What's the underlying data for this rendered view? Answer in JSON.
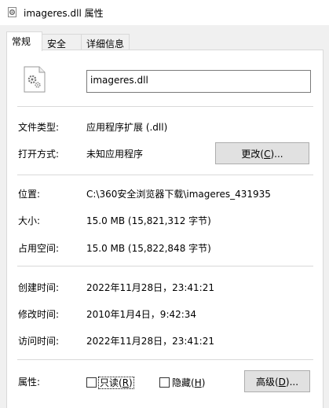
{
  "window": {
    "title": "imageres.dll 属性"
  },
  "tabs": [
    {
      "label": "常规",
      "active": true
    },
    {
      "label": "安全",
      "active": false
    },
    {
      "label": "详细信息",
      "active": false
    }
  ],
  "general": {
    "filename": "imageres.dll",
    "file_type": {
      "label": "文件类型:",
      "value": "应用程序扩展 (.dll)"
    },
    "opens_with": {
      "label": "打开方式:",
      "value": "未知应用程序"
    },
    "change_button": {
      "pre": "更改(",
      "key": "C",
      "post": ")..."
    },
    "location": {
      "label": "位置:",
      "value": "C:\\360安全浏览器下载\\imageres_431935"
    },
    "size": {
      "label": "大小:",
      "value": "15.0 MB (15,821,312 字节)"
    },
    "size_on_disk": {
      "label": "占用空间:",
      "value": "15.0 MB (15,822,848 字节)"
    },
    "created": {
      "label": "创建时间:",
      "value": "2022年11月28日，23:41:21"
    },
    "modified": {
      "label": "修改时间:",
      "value": "2010年1月4日，9:42:34"
    },
    "accessed": {
      "label": "访问时间:",
      "value": "2022年11月28日，23:41:21"
    },
    "attributes": {
      "label": "属性:",
      "readonly": {
        "pre": "只读(",
        "key": "R",
        "post": ")",
        "checked": false
      },
      "hidden": {
        "pre": "隐藏(",
        "key": "H",
        "post": ")",
        "checked": false
      },
      "advanced_button": {
        "pre": "高级(",
        "key": "D",
        "post": ")..."
      }
    }
  },
  "icons": {
    "title": "dll-gear-icon",
    "file": "dll-file-icon"
  }
}
